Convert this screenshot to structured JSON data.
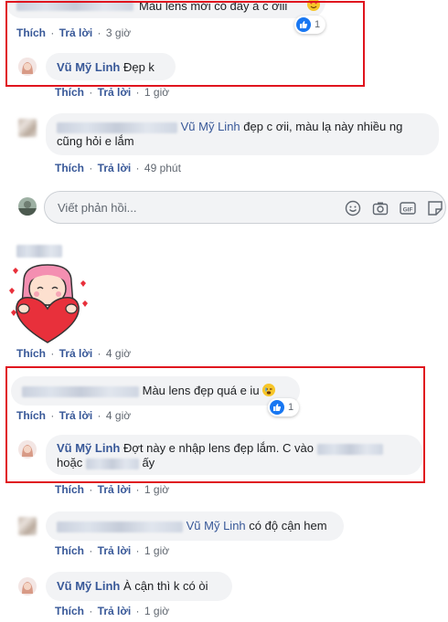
{
  "c1": {
    "text": "Màu lens mới có đây à c ơiii",
    "actions": {
      "like": "Thích",
      "reply": "Trả lời",
      "time": "3 giờ"
    },
    "reaction_count": "1"
  },
  "r1": {
    "author": "Vũ Mỹ Linh",
    "text": "Đẹp k",
    "actions": {
      "like": "Thích",
      "reply": "Trả lời",
      "time": "1 giờ"
    }
  },
  "c2": {
    "mention": "Vũ Mỹ Linh",
    "text_line1": "đẹp c ơii, màu lạ này nhiều ng",
    "text_line2": "cũng hỏi e lắm",
    "actions": {
      "like": "Thích",
      "reply": "Trả lời",
      "time": "49 phút"
    }
  },
  "composer": {
    "placeholder": "Viết phản hồi...",
    "icons": [
      "emoji-icon",
      "camera-icon",
      "gif-icon",
      "sticker-icon"
    ]
  },
  "c3": {
    "actions": {
      "like": "Thích",
      "reply": "Trả lời",
      "time": "4 giờ"
    }
  },
  "c4": {
    "text": "Màu lens đẹp quá e iu",
    "actions": {
      "like": "Thích",
      "reply": "Trả lời",
      "time": "4 giờ"
    },
    "reaction_count": "1"
  },
  "r2": {
    "author": "Vũ Mỹ Linh",
    "text_a": "Đợt này e nhập lens đẹp lắm. C vào",
    "text_b": "hoặc",
    "text_c": "ấy",
    "actions": {
      "like": "Thích",
      "reply": "Trả lời",
      "time": "1 giờ"
    }
  },
  "c5": {
    "mention": "Vũ Mỹ Linh",
    "text": "có độ cận hem",
    "actions": {
      "like": "Thích",
      "reply": "Trả lời",
      "time": "1 giờ"
    }
  },
  "r3": {
    "author": "Vũ Mỹ Linh",
    "text": "À cận thì k có òi",
    "actions": {
      "like": "Thích",
      "reply": "Trả lời",
      "time": "1 giờ"
    }
  },
  "colors": {
    "link": "#385898",
    "bubble": "#f2f3f5",
    "highlight_box": "#e0141e",
    "like_blue": "#1877f2",
    "meta_gray": "#606770"
  }
}
